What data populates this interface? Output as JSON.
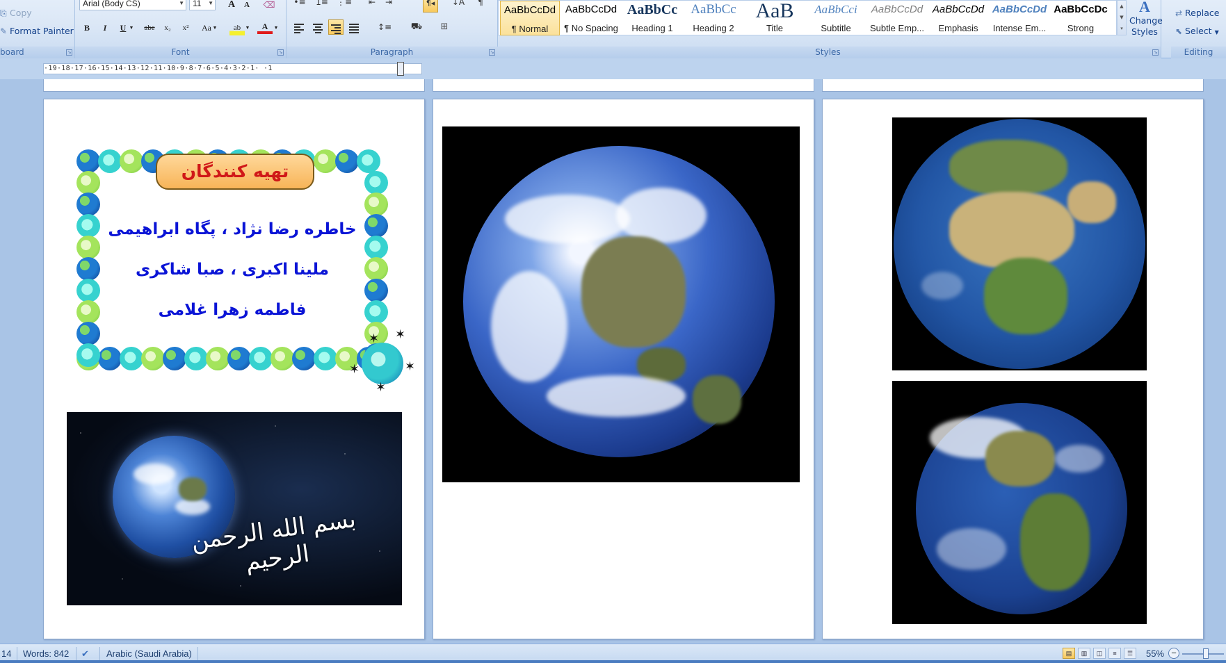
{
  "ribbon": {
    "clipboard": {
      "copy_label": "Copy",
      "format_painter_label": "Format Painter",
      "group_label": "board"
    },
    "font": {
      "font_name": "Arial (Body CS)",
      "font_size": "11",
      "grow_label": "A",
      "shrink_label": "A",
      "bold": "B",
      "italic": "I",
      "underline": "U",
      "strikethrough": "abe",
      "subscript": "x₂",
      "superscript": "x²",
      "change_case": "Aa",
      "highlight": "ab",
      "font_color": "A",
      "group_label": "Font"
    },
    "paragraph": {
      "group_label": "Paragraph"
    },
    "styles": {
      "items": [
        {
          "preview": "AaBbCcDd",
          "name": "¶ Normal"
        },
        {
          "preview": "AaBbCcDd",
          "name": "¶ No Spacing"
        },
        {
          "preview": "AaBbCc",
          "name": "Heading 1"
        },
        {
          "preview": "AaBbCc",
          "name": "Heading 2"
        },
        {
          "preview": "AaB",
          "name": "Title"
        },
        {
          "preview": "AaBbCci",
          "name": "Subtitle"
        },
        {
          "preview": "AaBbCcDd",
          "name": "Subtle Emp..."
        },
        {
          "preview": "AaBbCcDd",
          "name": "Emphasis"
        },
        {
          "preview": "AaBbCcDd",
          "name": "Intense Em..."
        },
        {
          "preview": "AaBbCcDc",
          "name": "Strong"
        }
      ],
      "change_styles_label": "Change Styles",
      "group_label": "Styles"
    },
    "editing": {
      "replace_label": "Replace",
      "select_label": "Select",
      "group_label": "Editing"
    }
  },
  "ruler": {
    "text": "·19·18·17·16·15·14·13·12·11·10·9·8·7·6·5·4·3·2·1· ·1"
  },
  "document": {
    "credits": {
      "title": "تهیه کنندگان",
      "lines": [
        "خاطره رضا نژاد ، پگاه ابراهیمی",
        "ملینا اکبری ، صبا شاکری",
        "فاطمه زهرا غلامی"
      ]
    },
    "calligraphy_text": "بسم الله الرحمن الرحیم"
  },
  "status_bar": {
    "page_fragment": "14",
    "words": "Words: 842",
    "language": "Arabic (Saudi Arabia)",
    "zoom": "55%"
  },
  "colors": {
    "credit_text": "#0a14d6",
    "credit_title": "#d01818",
    "ribbon_bg": "#dbe7f6",
    "canvas_bg": "#a9c4e6"
  }
}
